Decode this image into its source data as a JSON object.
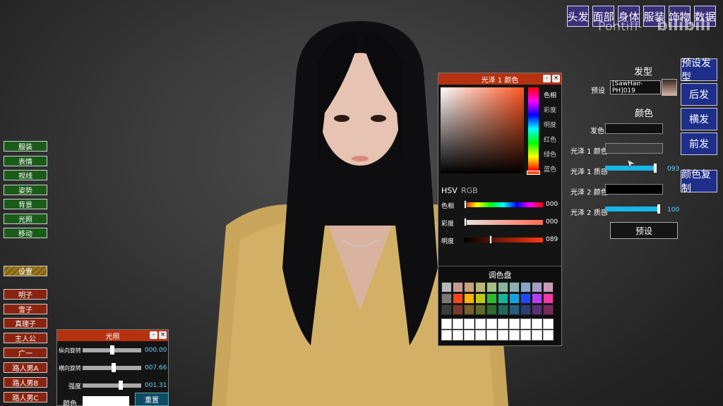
{
  "top_tabs": [
    "头发",
    "面部",
    "身体",
    "服装",
    "饰物",
    "数据"
  ],
  "watermark": {
    "text": "Pontiff-",
    "logo": "bilibili"
  },
  "left_menu": {
    "green": [
      "服装",
      "表情",
      "视线",
      "姿势",
      "背景",
      "光照",
      "移动"
    ],
    "settings": "设置",
    "characters": [
      "明子",
      "雪子",
      "真理子",
      "主人公",
      "广一",
      "路人男A",
      "路人男B",
      "路人男C"
    ]
  },
  "hair_panel": {
    "title": "发型",
    "preset_label": "预设",
    "preset_value": "[SawHair-PH]019",
    "color_title": "颜色",
    "hair_color_label": "发色",
    "gloss1_color_label": "光泽 1 颜色",
    "gloss1_texture_label": "光泽 1 质感",
    "gloss1_texture_value": "093",
    "gloss2_color_label": "光泽 2 颜色",
    "gloss2_texture_label": "光泽 2 质感",
    "gloss2_texture_value": "100",
    "preset_button": "预设",
    "colors": {
      "hair": "#111111",
      "gloss1": "#3c3c3c",
      "gloss2": "#000000",
      "accent": "#19b6e8"
    },
    "gloss1_texture_level": 0.93,
    "gloss2_texture_level": 1.0
  },
  "right_buttons": [
    "预设发型",
    "后发",
    "横发",
    "前发",
    "颜色复制"
  ],
  "color_window": {
    "title": "光泽 1 颜色",
    "side_labels": [
      "色相",
      "彩度",
      "明度",
      "红色",
      "绿色",
      "蓝色"
    ],
    "mode_hsv": "HSV",
    "mode_rgb": "RGB",
    "hue_label": "色相",
    "hue_value": "000",
    "sat_label": "彩度",
    "sat_value": "000",
    "val_label": "明度",
    "val_value": "089",
    "palette_title": "调色盘"
  },
  "light_window": {
    "title": "光照",
    "vrot_label": "纵向旋转",
    "vrot_value": "000.00",
    "hrot_label": "横向旋转",
    "hrot_value": "007.66",
    "intensity_label": "强度",
    "intensity_value": "001.31",
    "color_label": "颜色",
    "reset_button": "重置"
  },
  "palette_colors": [
    [
      "#b8b8b8",
      "#c79a90",
      "#c8a07a",
      "#b9b77a",
      "#a5be86",
      "#88b49b",
      "#8bb0b4",
      "#88a6c8",
      "#a79bc7",
      "#c79ab8"
    ],
    [
      "#7a7a7a",
      "#ff4418",
      "#ffb200",
      "#bdcb10",
      "#2fbd2f",
      "#17b39a",
      "#17a0e0",
      "#1f48ff",
      "#b83df2",
      "#f03aa8"
    ],
    [
      "#3c3c3c",
      "#7a3a2a",
      "#7a5f2a",
      "#5e6a2a",
      "#2f6a2f",
      "#1f6a5f",
      "#23607a",
      "#2a3f7a",
      "#5a2f7a",
      "#7a2a5a"
    ]
  ]
}
